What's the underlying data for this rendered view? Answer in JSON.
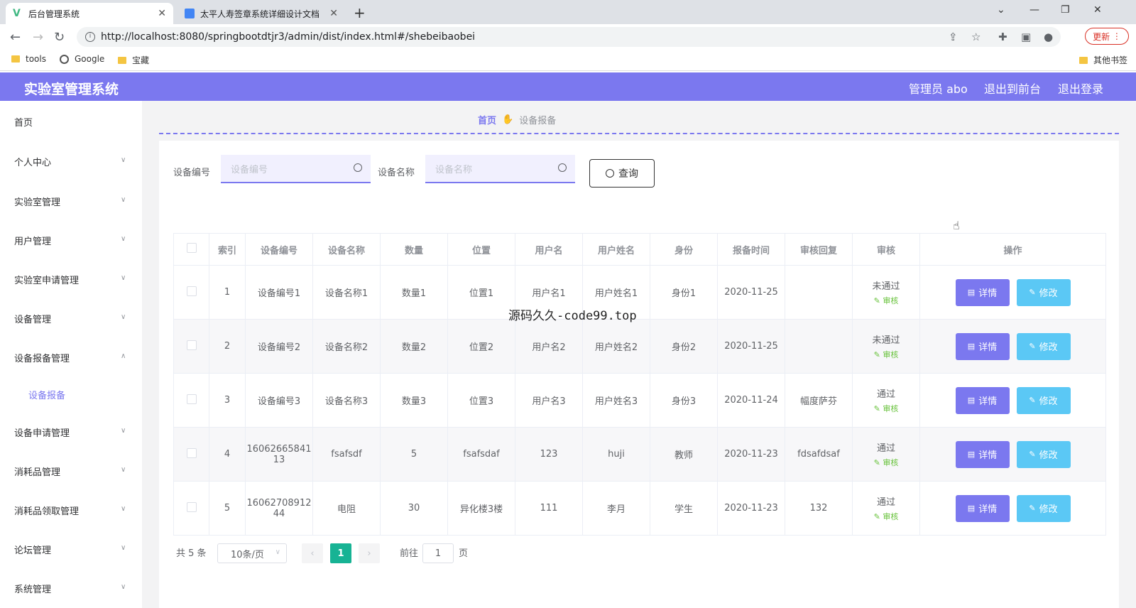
{
  "browser": {
    "tabs": [
      {
        "title": "后台管理系统",
        "active": true
      },
      {
        "title": "太平人寿签章系统详细设计文档",
        "active": false
      }
    ],
    "url": "http://localhost:8080/springbootdtjr3/admin/dist/index.html#/shebeibaobei",
    "update_label": "更新",
    "bookmarks": [
      "tools",
      "Google",
      "宝藏"
    ],
    "other_bookmarks": "其他书签"
  },
  "header": {
    "title": "实验室管理系统",
    "user": "管理员 abo",
    "back_to_front": "退出到前台",
    "logout": "退出登录",
    "color": "#7b78ef"
  },
  "sidebar": {
    "items": [
      {
        "label": "首页",
        "has_children": false
      },
      {
        "label": "个人中心",
        "has_children": true
      },
      {
        "label": "实验室管理",
        "has_children": true
      },
      {
        "label": "用户管理",
        "has_children": true
      },
      {
        "label": "实验室申请管理",
        "has_children": true
      },
      {
        "label": "设备管理",
        "has_children": true
      },
      {
        "label": "设备报备管理",
        "has_children": true,
        "expanded": true
      },
      {
        "label": "设备申请管理",
        "has_children": true
      },
      {
        "label": "消耗品管理",
        "has_children": true
      },
      {
        "label": "消耗品领取管理",
        "has_children": true
      },
      {
        "label": "论坛管理",
        "has_children": true
      },
      {
        "label": "系统管理",
        "has_children": true
      }
    ],
    "sub_item": "设备报备"
  },
  "breadcrumb": {
    "home": "首页",
    "current": "设备报备"
  },
  "filters": {
    "device_no_label": "设备编号",
    "device_no_placeholder": "设备编号",
    "device_name_label": "设备名称",
    "device_name_placeholder": "设备名称",
    "query_label": "查询"
  },
  "table": {
    "columns": [
      "索引",
      "设备编号",
      "设备名称",
      "数量",
      "位置",
      "用户名",
      "用户姓名",
      "身份",
      "报备时间",
      "审核回复",
      "审核",
      "操作"
    ],
    "rows": [
      {
        "index": "1",
        "device_no": "设备编号1",
        "device_name": "设备名称1",
        "qty": "数量1",
        "location": "位置1",
        "username": "用户名1",
        "realname": "用户姓名1",
        "identity": "身份1",
        "time": "2020-11-25",
        "reply": "",
        "status": "未通过",
        "audit": "审核"
      },
      {
        "index": "2",
        "device_no": "设备编号2",
        "device_name": "设备名称2",
        "qty": "数量2",
        "location": "位置2",
        "username": "用户名2",
        "realname": "用户姓名2",
        "identity": "身份2",
        "time": "2020-11-25",
        "reply": "",
        "status": "未通过",
        "audit": "审核"
      },
      {
        "index": "3",
        "device_no": "设备编号3",
        "device_name": "设备名称3",
        "qty": "数量3",
        "location": "位置3",
        "username": "用户名3",
        "realname": "用户姓名3",
        "identity": "身份3",
        "time": "2020-11-24",
        "reply": "幅度萨芬",
        "status": "通过",
        "audit": "审核"
      },
      {
        "index": "4",
        "device_no": "1606266584113",
        "device_name": "fsafsdf",
        "qty": "5",
        "location": "fsafsdaf",
        "username": "123",
        "realname": "huji",
        "identity": "教师",
        "time": "2020-11-23",
        "reply": "fdsafdsaf",
        "status": "通过",
        "audit": "审核"
      },
      {
        "index": "5",
        "device_no": "1606270891244",
        "device_name": "电阻",
        "qty": "30",
        "location": "异化楼3楼",
        "username": "111",
        "realname": "李月",
        "identity": "学生",
        "time": "2020-11-23",
        "reply": "132",
        "status": "通过",
        "audit": "审核"
      }
    ],
    "detail_label": "详情",
    "edit_label": "修改"
  },
  "pagination": {
    "total": "共 5 条",
    "page_size": "10条/页",
    "current_page": "1",
    "goto_prefix": "前往",
    "goto_value": "1",
    "goto_suffix": "页"
  },
  "overlay_text": "源码久久-code99.top"
}
